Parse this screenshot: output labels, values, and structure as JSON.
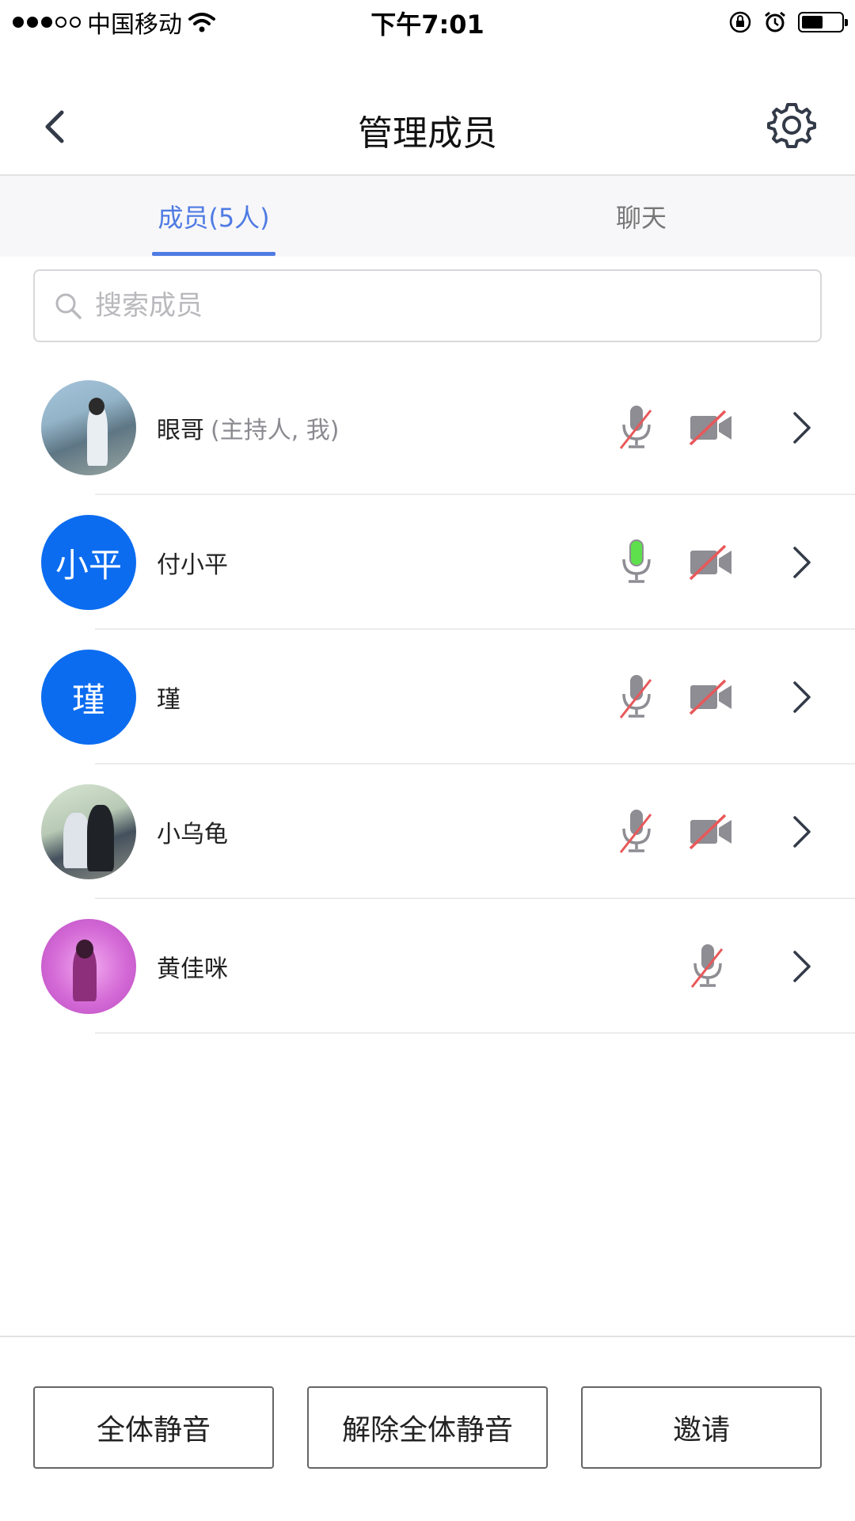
{
  "status_bar": {
    "carrier": "中国移动",
    "time": "下午7:01",
    "battery_level": 0.55,
    "icons": [
      "signal-dots-icon",
      "wifi-icon",
      "rotation-lock-icon",
      "alarm-icon",
      "battery-icon"
    ]
  },
  "nav": {
    "title": "管理成员",
    "back_icon": "chevron-left-icon",
    "settings_icon": "gear-icon"
  },
  "tabs": [
    {
      "label": "成员(5人)",
      "active": true
    },
    {
      "label": "聊天",
      "active": false
    }
  ],
  "search": {
    "placeholder": "搜索成员",
    "value": ""
  },
  "members": [
    {
      "name": "眼哥",
      "note": "(主持人, 我)",
      "avatar": "photo",
      "mic": "muted",
      "camera": "off"
    },
    {
      "name": "付小平",
      "note": "",
      "avatar_text": "小平",
      "mic": "active",
      "camera": "off"
    },
    {
      "name": "瑾",
      "note": "",
      "avatar_text": "瑾",
      "mic": "muted",
      "camera": "off"
    },
    {
      "name": "小乌龟",
      "note": "",
      "avatar": "photo",
      "mic": "muted",
      "camera": "off"
    },
    {
      "name": "黄佳咪",
      "note": "",
      "avatar": "photo",
      "mic": "muted",
      "camera": "none"
    }
  ],
  "actions": {
    "mute_all": "全体静音",
    "unmute_all": "解除全体静音",
    "invite": "邀请"
  },
  "colors": {
    "accent": "#4f7be3",
    "avatar_blue": "#0b6cf0",
    "mic_active": "#5ee04c",
    "muted_slash": "#e8585a",
    "icon_gray": "#8d8d93"
  }
}
